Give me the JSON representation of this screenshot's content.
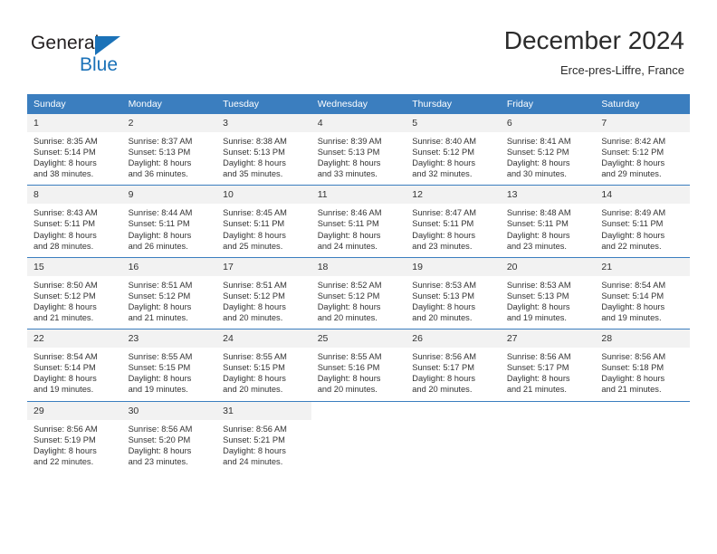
{
  "brand": {
    "name_top": "General",
    "name_bottom": "Blue",
    "color_blue": "#1b72b8",
    "color_dark": "#231f20"
  },
  "header": {
    "title": "December 2024",
    "subtitle": "Erce-pres-Liffre, France"
  },
  "theme": {
    "header_blue": "#3b7ebf",
    "daynum_bg": "#f2f2f2",
    "text": "#333333"
  },
  "weekday_headers": [
    "Sunday",
    "Monday",
    "Tuesday",
    "Wednesday",
    "Thursday",
    "Friday",
    "Saturday"
  ],
  "weeks": [
    [
      {
        "day": "1",
        "sunrise": "Sunrise: 8:35 AM",
        "sunset": "Sunset: 5:14 PM",
        "daylight_line1": "Daylight: 8 hours",
        "daylight_line2": "and 38 minutes."
      },
      {
        "day": "2",
        "sunrise": "Sunrise: 8:37 AM",
        "sunset": "Sunset: 5:13 PM",
        "daylight_line1": "Daylight: 8 hours",
        "daylight_line2": "and 36 minutes."
      },
      {
        "day": "3",
        "sunrise": "Sunrise: 8:38 AM",
        "sunset": "Sunset: 5:13 PM",
        "daylight_line1": "Daylight: 8 hours",
        "daylight_line2": "and 35 minutes."
      },
      {
        "day": "4",
        "sunrise": "Sunrise: 8:39 AM",
        "sunset": "Sunset: 5:13 PM",
        "daylight_line1": "Daylight: 8 hours",
        "daylight_line2": "and 33 minutes."
      },
      {
        "day": "5",
        "sunrise": "Sunrise: 8:40 AM",
        "sunset": "Sunset: 5:12 PM",
        "daylight_line1": "Daylight: 8 hours",
        "daylight_line2": "and 32 minutes."
      },
      {
        "day": "6",
        "sunrise": "Sunrise: 8:41 AM",
        "sunset": "Sunset: 5:12 PM",
        "daylight_line1": "Daylight: 8 hours",
        "daylight_line2": "and 30 minutes."
      },
      {
        "day": "7",
        "sunrise": "Sunrise: 8:42 AM",
        "sunset": "Sunset: 5:12 PM",
        "daylight_line1": "Daylight: 8 hours",
        "daylight_line2": "and 29 minutes."
      }
    ],
    [
      {
        "day": "8",
        "sunrise": "Sunrise: 8:43 AM",
        "sunset": "Sunset: 5:11 PM",
        "daylight_line1": "Daylight: 8 hours",
        "daylight_line2": "and 28 minutes."
      },
      {
        "day": "9",
        "sunrise": "Sunrise: 8:44 AM",
        "sunset": "Sunset: 5:11 PM",
        "daylight_line1": "Daylight: 8 hours",
        "daylight_line2": "and 26 minutes."
      },
      {
        "day": "10",
        "sunrise": "Sunrise: 8:45 AM",
        "sunset": "Sunset: 5:11 PM",
        "daylight_line1": "Daylight: 8 hours",
        "daylight_line2": "and 25 minutes."
      },
      {
        "day": "11",
        "sunrise": "Sunrise: 8:46 AM",
        "sunset": "Sunset: 5:11 PM",
        "daylight_line1": "Daylight: 8 hours",
        "daylight_line2": "and 24 minutes."
      },
      {
        "day": "12",
        "sunrise": "Sunrise: 8:47 AM",
        "sunset": "Sunset: 5:11 PM",
        "daylight_line1": "Daylight: 8 hours",
        "daylight_line2": "and 23 minutes."
      },
      {
        "day": "13",
        "sunrise": "Sunrise: 8:48 AM",
        "sunset": "Sunset: 5:11 PM",
        "daylight_line1": "Daylight: 8 hours",
        "daylight_line2": "and 23 minutes."
      },
      {
        "day": "14",
        "sunrise": "Sunrise: 8:49 AM",
        "sunset": "Sunset: 5:11 PM",
        "daylight_line1": "Daylight: 8 hours",
        "daylight_line2": "and 22 minutes."
      }
    ],
    [
      {
        "day": "15",
        "sunrise": "Sunrise: 8:50 AM",
        "sunset": "Sunset: 5:12 PM",
        "daylight_line1": "Daylight: 8 hours",
        "daylight_line2": "and 21 minutes."
      },
      {
        "day": "16",
        "sunrise": "Sunrise: 8:51 AM",
        "sunset": "Sunset: 5:12 PM",
        "daylight_line1": "Daylight: 8 hours",
        "daylight_line2": "and 21 minutes."
      },
      {
        "day": "17",
        "sunrise": "Sunrise: 8:51 AM",
        "sunset": "Sunset: 5:12 PM",
        "daylight_line1": "Daylight: 8 hours",
        "daylight_line2": "and 20 minutes."
      },
      {
        "day": "18",
        "sunrise": "Sunrise: 8:52 AM",
        "sunset": "Sunset: 5:12 PM",
        "daylight_line1": "Daylight: 8 hours",
        "daylight_line2": "and 20 minutes."
      },
      {
        "day": "19",
        "sunrise": "Sunrise: 8:53 AM",
        "sunset": "Sunset: 5:13 PM",
        "daylight_line1": "Daylight: 8 hours",
        "daylight_line2": "and 20 minutes."
      },
      {
        "day": "20",
        "sunrise": "Sunrise: 8:53 AM",
        "sunset": "Sunset: 5:13 PM",
        "daylight_line1": "Daylight: 8 hours",
        "daylight_line2": "and 19 minutes."
      },
      {
        "day": "21",
        "sunrise": "Sunrise: 8:54 AM",
        "sunset": "Sunset: 5:14 PM",
        "daylight_line1": "Daylight: 8 hours",
        "daylight_line2": "and 19 minutes."
      }
    ],
    [
      {
        "day": "22",
        "sunrise": "Sunrise: 8:54 AM",
        "sunset": "Sunset: 5:14 PM",
        "daylight_line1": "Daylight: 8 hours",
        "daylight_line2": "and 19 minutes."
      },
      {
        "day": "23",
        "sunrise": "Sunrise: 8:55 AM",
        "sunset": "Sunset: 5:15 PM",
        "daylight_line1": "Daylight: 8 hours",
        "daylight_line2": "and 19 minutes."
      },
      {
        "day": "24",
        "sunrise": "Sunrise: 8:55 AM",
        "sunset": "Sunset: 5:15 PM",
        "daylight_line1": "Daylight: 8 hours",
        "daylight_line2": "and 20 minutes."
      },
      {
        "day": "25",
        "sunrise": "Sunrise: 8:55 AM",
        "sunset": "Sunset: 5:16 PM",
        "daylight_line1": "Daylight: 8 hours",
        "daylight_line2": "and 20 minutes."
      },
      {
        "day": "26",
        "sunrise": "Sunrise: 8:56 AM",
        "sunset": "Sunset: 5:17 PM",
        "daylight_line1": "Daylight: 8 hours",
        "daylight_line2": "and 20 minutes."
      },
      {
        "day": "27",
        "sunrise": "Sunrise: 8:56 AM",
        "sunset": "Sunset: 5:17 PM",
        "daylight_line1": "Daylight: 8 hours",
        "daylight_line2": "and 21 minutes."
      },
      {
        "day": "28",
        "sunrise": "Sunrise: 8:56 AM",
        "sunset": "Sunset: 5:18 PM",
        "daylight_line1": "Daylight: 8 hours",
        "daylight_line2": "and 21 minutes."
      }
    ],
    [
      {
        "day": "29",
        "sunrise": "Sunrise: 8:56 AM",
        "sunset": "Sunset: 5:19 PM",
        "daylight_line1": "Daylight: 8 hours",
        "daylight_line2": "and 22 minutes."
      },
      {
        "day": "30",
        "sunrise": "Sunrise: 8:56 AM",
        "sunset": "Sunset: 5:20 PM",
        "daylight_line1": "Daylight: 8 hours",
        "daylight_line2": "and 23 minutes."
      },
      {
        "day": "31",
        "sunrise": "Sunrise: 8:56 AM",
        "sunset": "Sunset: 5:21 PM",
        "daylight_line1": "Daylight: 8 hours",
        "daylight_line2": "and 24 minutes."
      },
      {
        "day": "",
        "sunrise": "",
        "sunset": "",
        "daylight_line1": "",
        "daylight_line2": ""
      },
      {
        "day": "",
        "sunrise": "",
        "sunset": "",
        "daylight_line1": "",
        "daylight_line2": ""
      },
      {
        "day": "",
        "sunrise": "",
        "sunset": "",
        "daylight_line1": "",
        "daylight_line2": ""
      },
      {
        "day": "",
        "sunrise": "",
        "sunset": "",
        "daylight_line1": "",
        "daylight_line2": ""
      }
    ]
  ]
}
